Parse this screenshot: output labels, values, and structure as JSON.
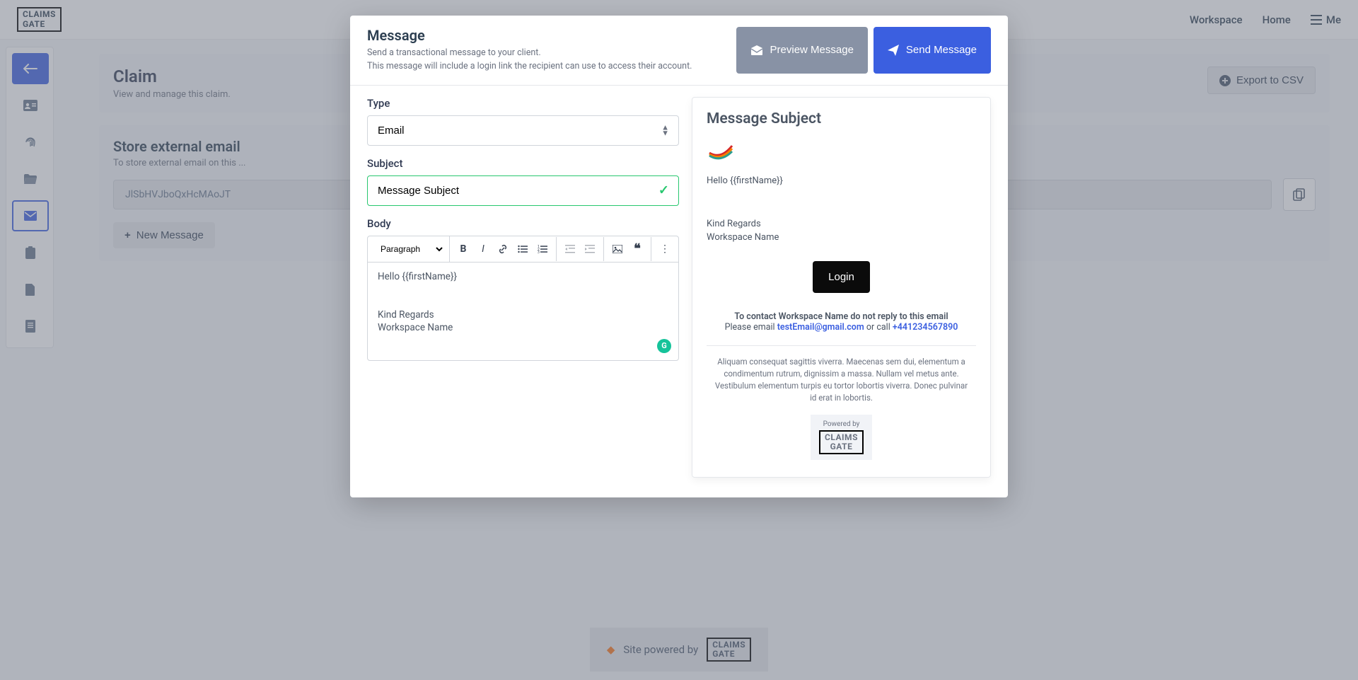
{
  "brand": {
    "line1": "CLAIMS",
    "line2": "GATE"
  },
  "topnav": {
    "workspace": "Workspace",
    "home": "Home",
    "me": "Me"
  },
  "page": {
    "title": "Claim",
    "subtitle": "View and manage this claim.",
    "export": "Export to CSV"
  },
  "section": {
    "title": "Store external email",
    "subtitle": "To store external email on this ...",
    "token": "JlSbHVJboQxHcMAoJT",
    "newMessage": "New Message"
  },
  "footer": {
    "text": "Site powered by"
  },
  "modal": {
    "title": "Message",
    "desc1": "Send a transactional message to your client.",
    "desc2": "This message will include a login link the recipient can use to access their account.",
    "preview": "Preview Message",
    "send": "Send Message",
    "form": {
      "typeLabel": "Type",
      "typeValue": "Email",
      "subjectLabel": "Subject",
      "subjectValue": "Message Subject",
      "bodyLabel": "Body",
      "paragraph": "Paragraph",
      "bodyLine1": "Hello {{firstName}}",
      "bodyLine2": "Kind Regards",
      "bodyLine3": "Workspace Name"
    },
    "previewPane": {
      "subject": "Message Subject",
      "greeting": "Hello {{firstName}}",
      "closing1": "Kind Regards",
      "closing2": "Workspace Name",
      "login": "Login",
      "contactBold": "To contact Workspace Name do not reply to this email",
      "pleaseEmail": "Please email ",
      "email": "testEmail@gmail.com",
      "orCall": " or call ",
      "phone": "+441234567890",
      "legal": "Aliquam consequat sagittis viverra. Maecenas sem dui, elementum a condimentum rutrum, dignissim a massa. Nullam vel metus ante. Vestibulum elementum turpis eu tortor lobortis viverra. Donec pulvinar id erat in lobortis.",
      "poweredBy": "Powered by"
    }
  }
}
